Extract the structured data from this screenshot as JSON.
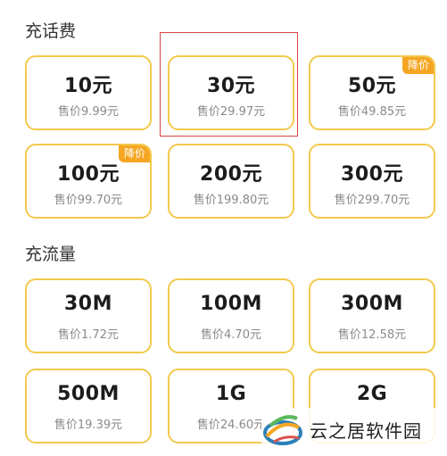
{
  "sections": {
    "calls": {
      "title": "充话费",
      "cards": [
        {
          "amount": "10元",
          "price": "售价9.99元"
        },
        {
          "amount": "30元",
          "price": "售价29.97元"
        },
        {
          "amount": "50元",
          "price": "售价49.85元",
          "badge": "降价"
        },
        {
          "amount": "100元",
          "price": "售价99.70元",
          "badge": "降价"
        },
        {
          "amount": "200元",
          "price": "售价199.80元"
        },
        {
          "amount": "300元",
          "price": "售价299.70元"
        }
      ]
    },
    "data": {
      "title": "充流量",
      "cards": [
        {
          "amount": "30M",
          "price": "售价1.72元"
        },
        {
          "amount": "100M",
          "price": "售价4.70元"
        },
        {
          "amount": "300M",
          "price": "售价12.58元"
        },
        {
          "amount": "500M",
          "price": "售价19.39元"
        },
        {
          "amount": "1G",
          "price": "售价24.60元"
        },
        {
          "amount": "2G",
          "price": ""
        }
      ]
    }
  },
  "watermark": {
    "text": "云之居软件园",
    "logo": "swirl-logo-icon"
  },
  "colors": {
    "card_border": "#f2c94c",
    "badge_bg": "#f5a623",
    "highlight": "#d64545"
  }
}
